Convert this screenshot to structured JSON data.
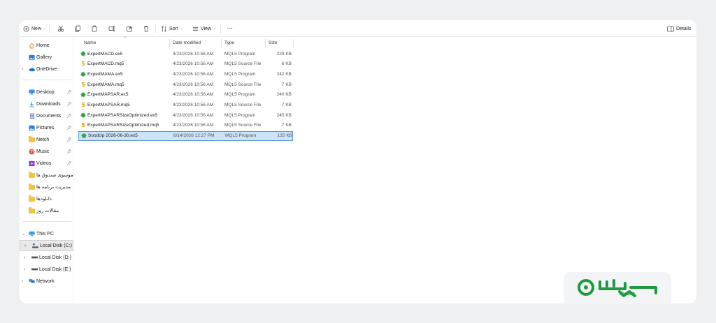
{
  "toolbar": {
    "new_label": "New",
    "sort_label": "Sort",
    "view_label": "View",
    "more_label": "···",
    "details_label": "Details"
  },
  "sidebar": {
    "quick": [
      {
        "label": "Home",
        "icon": "home-icon"
      },
      {
        "label": "Gallery",
        "icon": "gallery-icon"
      },
      {
        "label": "OneDrive",
        "icon": "cloud-icon"
      }
    ],
    "pinned": [
      {
        "label": "Desktop",
        "icon": "desktop-icon"
      },
      {
        "label": "Downloads",
        "icon": "download-icon"
      },
      {
        "label": "Documents",
        "icon": "documents-icon"
      },
      {
        "label": "Pictures",
        "icon": "pictures-icon"
      },
      {
        "label": "Netch",
        "icon": "folder-icon"
      },
      {
        "label": "Music",
        "icon": "music-icon"
      },
      {
        "label": "Videos",
        "icon": "videos-icon"
      }
    ],
    "folders": [
      {
        "label": "موسوی صندوق ها"
      },
      {
        "label": "مدیریت برنامه ها"
      },
      {
        "label": "دانلودها"
      },
      {
        "label": "مقالات روز"
      }
    ],
    "this_pc": "This PC",
    "drives": [
      {
        "label": "Local Disk (C:)"
      },
      {
        "label": "Local Disk (D:)"
      },
      {
        "label": "Local Disk (E:)"
      }
    ],
    "network": "Network"
  },
  "columns": {
    "name": "Name",
    "date": "Date modified",
    "type": "Type",
    "size": "Size"
  },
  "files": [
    {
      "name": "ExpertMACD.ex5",
      "date": "4/23/2026 10:56 AM",
      "type": "MQL5 Program",
      "size": "229 KB",
      "kind": "ex5"
    },
    {
      "name": "ExpertMACD.mq5",
      "date": "4/23/2026 10:56 AM",
      "type": "MQL5 Source File",
      "size": "6 KB",
      "kind": "mq5"
    },
    {
      "name": "ExpertMAMA.ex5",
      "date": "4/23/2026 10:56 AM",
      "type": "MQL5 Program",
      "size": "242 KB",
      "kind": "ex5"
    },
    {
      "name": "ExpertMAMA.mq5",
      "date": "4/23/2026 10:56 AM",
      "type": "MQL5 Source File",
      "size": "7 KB",
      "kind": "mq5"
    },
    {
      "name": "ExpertMAPSAR.ex5",
      "date": "4/23/2026 10:56 AM",
      "type": "MQL5 Program",
      "size": "240 KB",
      "kind": "ex5"
    },
    {
      "name": "ExpertMAPSAR.mq5",
      "date": "4/23/2026 10:56 AM",
      "type": "MQL5 Source File",
      "size": "7 KB",
      "kind": "mq5"
    },
    {
      "name": "ExpertMAPSARSizeOptimized.ex5",
      "date": "4/23/2026 10:56 AM",
      "type": "MQL5 Program",
      "size": "245 KB",
      "kind": "ex5"
    },
    {
      "name": "ExpertMAPSARSizeOptimized.mq5",
      "date": "4/23/2026 10:56 AM",
      "type": "MQL5 Source File",
      "size": "7 KB",
      "kind": "mq5"
    },
    {
      "name": "SoodUp 2026-06-30.ex5",
      "date": "6/14/2026 12:27 PM",
      "type": "MQL5 Program",
      "size": "135 KB",
      "kind": "ex5",
      "selected": true
    }
  ],
  "logo": {
    "text": "SOODUP",
    "color": "#1f9a3f"
  }
}
